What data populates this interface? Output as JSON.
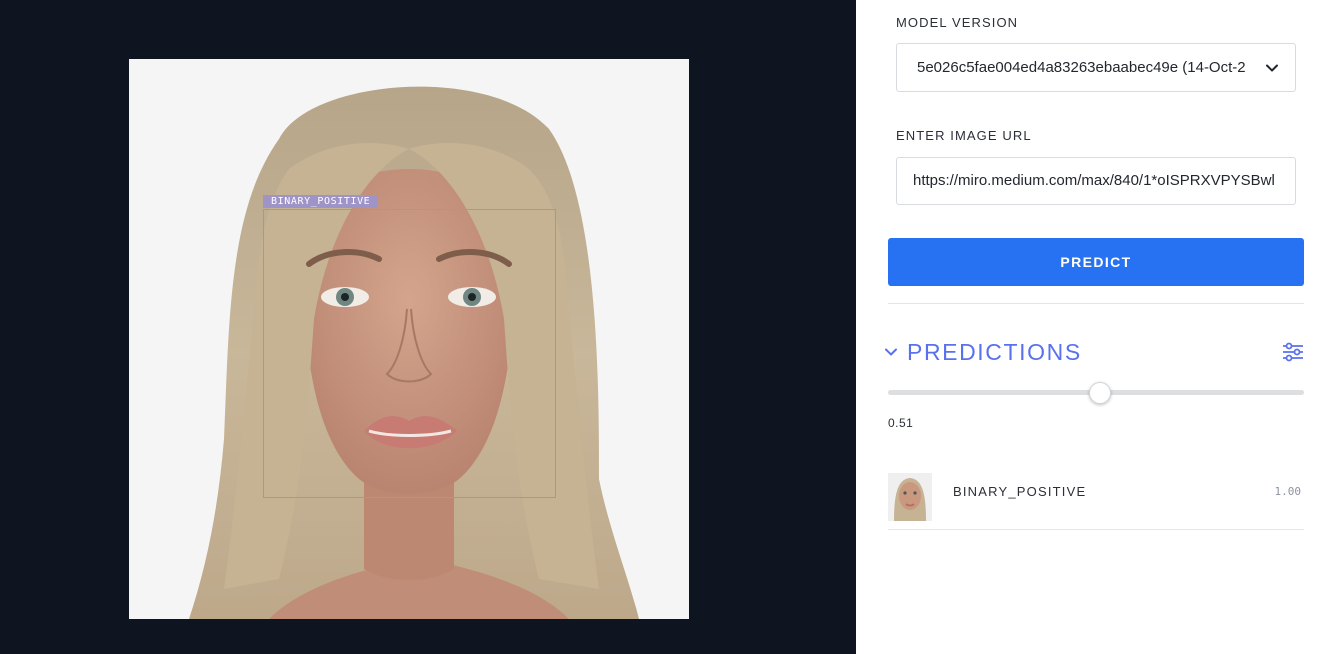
{
  "viewer": {
    "detection_label": "BINARY_POSITIVE"
  },
  "panel": {
    "model_version_label": "MODEL VERSION",
    "model_version_value": "5e026c5fae004ed4a83263ebaabec49e (14-Oct-2",
    "image_url_label": "ENTER IMAGE URL",
    "image_url_value": "https://miro.medium.com/max/840/1*oISPRXVPYSBwl",
    "predict_label": "PREDICT",
    "predictions_title": "PREDICTIONS",
    "threshold": "0.51",
    "threshold_fraction": 0.51,
    "results": [
      {
        "label": "BINARY_POSITIVE",
        "score": "1.00"
      }
    ]
  },
  "colors": {
    "viewer_bg": "#0f1520",
    "accent": "#2672f2",
    "predictions_title": "#5a71ee",
    "bbox": "#9e94c8"
  },
  "icons": {
    "select_chevron": "chevron-down-icon",
    "predictions_chevron": "chevron-down-icon",
    "filter": "sliders-icon"
  }
}
